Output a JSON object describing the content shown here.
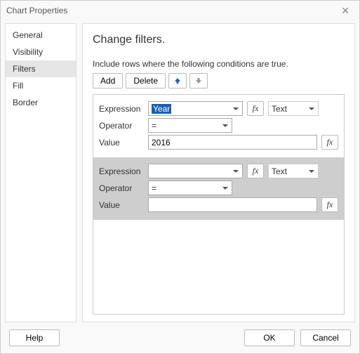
{
  "title": "Chart Properties",
  "sidebar": {
    "items": [
      {
        "label": "General"
      },
      {
        "label": "Visibility"
      },
      {
        "label": "Filters"
      },
      {
        "label": "Fill"
      },
      {
        "label": "Border"
      }
    ],
    "active_index": 2
  },
  "content": {
    "heading": "Change filters.",
    "instruction": "Include rows where the following conditions are true.",
    "toolbar": {
      "add_label": "Add",
      "delete_label": "Delete"
    },
    "labels": {
      "expression": "Expression",
      "operator": "Operator",
      "value": "Value"
    },
    "filters": [
      {
        "expression": "Year",
        "operator": "=",
        "value": "2016",
        "type": "Text",
        "selected": false,
        "expression_highlighted": true
      },
      {
        "expression": "",
        "operator": "=",
        "value": "",
        "type": "Text",
        "selected": true,
        "expression_highlighted": false
      }
    ]
  },
  "footer": {
    "help_label": "Help",
    "ok_label": "OK",
    "cancel_label": "Cancel"
  },
  "icons": {
    "fx": "fx"
  }
}
